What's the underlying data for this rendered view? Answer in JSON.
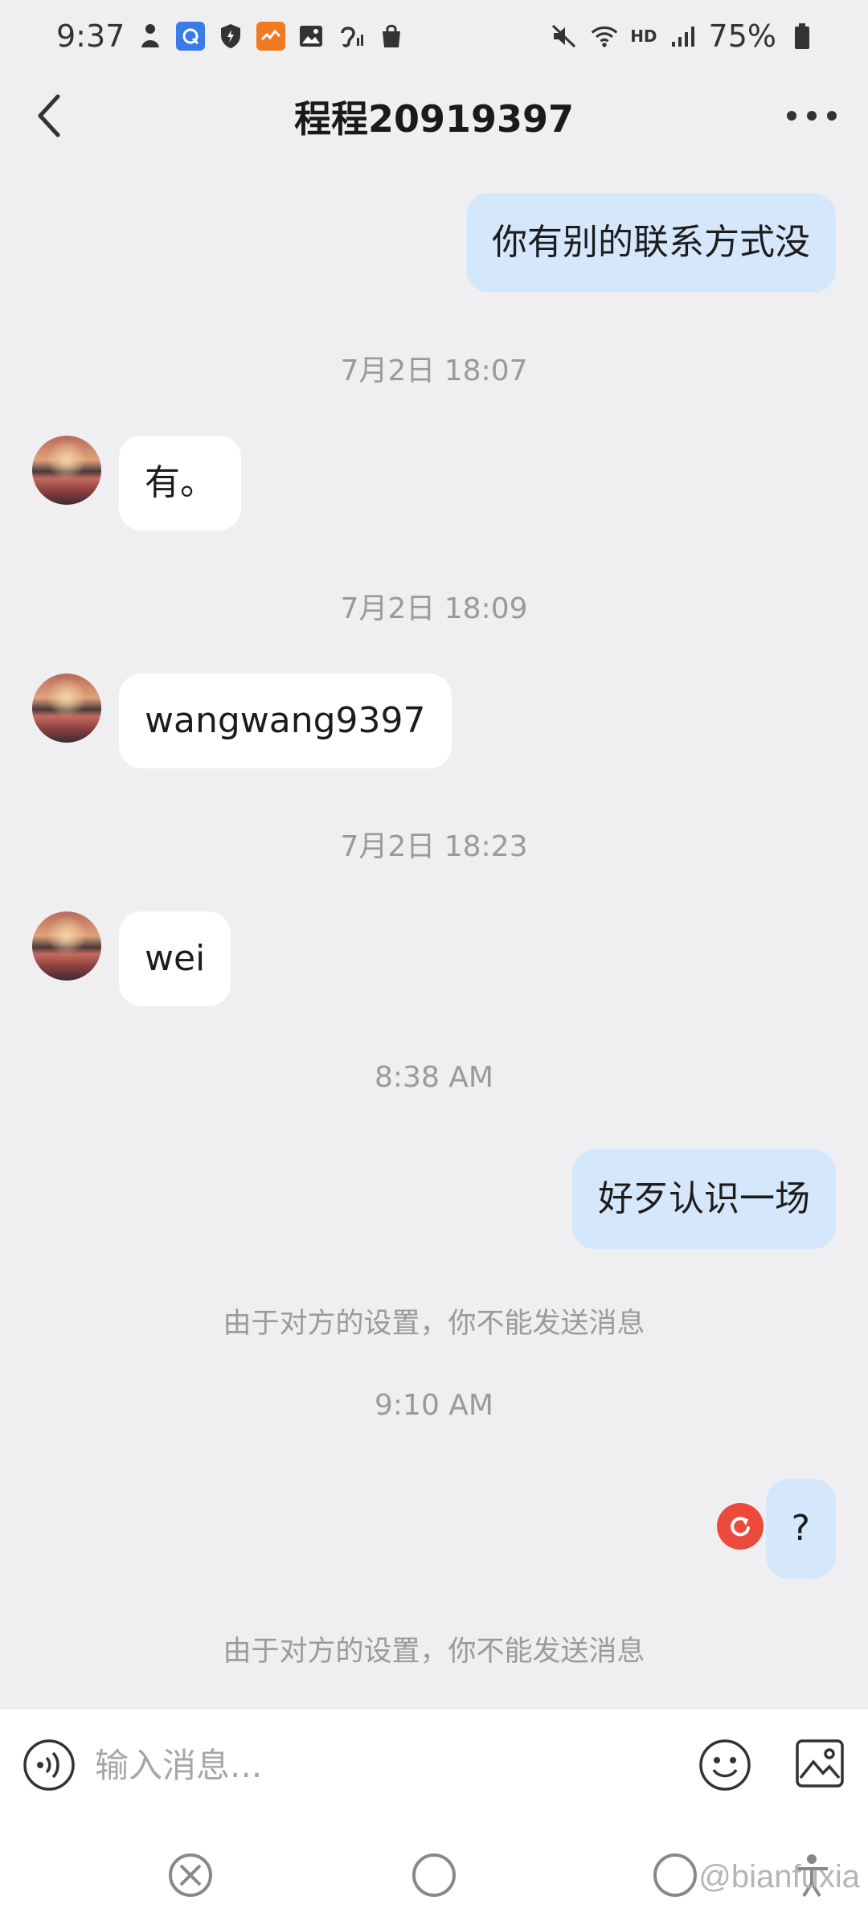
{
  "status_bar": {
    "time": "9:37",
    "hd_label": "HD",
    "battery": "75%"
  },
  "header": {
    "title": "程程20919397"
  },
  "messages": [
    {
      "side": "sent",
      "text": "你有别的联系方式没"
    },
    {
      "type": "timestamp",
      "text": "7月2日 18:07"
    },
    {
      "side": "received",
      "text": "有。"
    },
    {
      "type": "timestamp",
      "text": "7月2日 18:09"
    },
    {
      "side": "received",
      "text": "wangwang9397"
    },
    {
      "type": "timestamp",
      "text": "7月2日 18:23"
    },
    {
      "side": "received",
      "text": "wei"
    },
    {
      "type": "timestamp",
      "text": "8:38 AM"
    },
    {
      "side": "sent",
      "text": "好歹认识一场",
      "failed": true
    },
    {
      "type": "notice",
      "text": "由于对方的设置，你不能发送消息"
    },
    {
      "type": "timestamp",
      "text": "9:10 AM"
    },
    {
      "side": "sent",
      "text": "?",
      "failed": true
    },
    {
      "type": "notice",
      "text": "由于对方的设置，你不能发送消息"
    }
  ],
  "input_bar": {
    "placeholder": "输入消息..."
  },
  "watermark": "@bianfuxia",
  "icons": [
    "back-arrow-icon",
    "more-dots-icon",
    "voice-icon",
    "emoji-icon",
    "image-icon",
    "resend-icon"
  ],
  "colors": {
    "background": "#efeff1",
    "sent_bubble": "#d5e8fb",
    "received_bubble": "#ffffff",
    "resend": "#ec4a3c",
    "timestamp": "#9a9a9a"
  }
}
